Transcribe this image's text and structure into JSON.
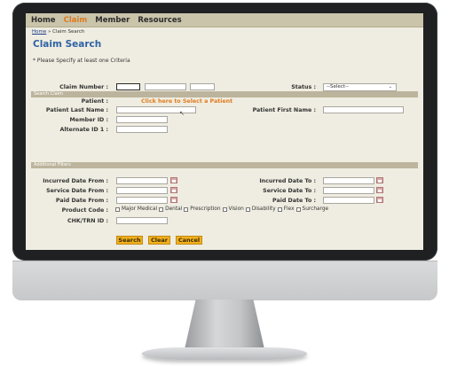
{
  "nav": {
    "home": "Home",
    "claim": "Claim",
    "member": "Member",
    "resources": "Resources"
  },
  "breadcrumb": {
    "home": "Home",
    "separator": " » ",
    "current": "Claim Search"
  },
  "page_title": "Claim Search",
  "criteria_note": "* Please Specify at least one Criteria",
  "search_claim": {
    "section_label": "Search Claim",
    "claim_number_label": "Claim Number :",
    "status_label": "Status :",
    "status_value": "--Select--",
    "patient_label": "Patient :",
    "patient_link": "Click here to Select a Patient",
    "patient_last_label": "Patient Last Name :",
    "patient_first_label": "Patient First Name :",
    "member_id_label": "Member ID :",
    "alternate_id_label": "Alternate ID 1 :"
  },
  "additional_filters": {
    "section_label": "Additional Filters",
    "incurred_from": "Incurred Date From :",
    "incurred_to": "Incurred Date To :",
    "service_from": "Service Date From :",
    "service_to": "Service Date To :",
    "paid_from": "Paid Date From :",
    "paid_to": "Paid Date To :",
    "product_code_label": "Product Code :",
    "products": [
      "Major Medical",
      "Dental",
      "Prescription",
      "Vision",
      "Disability",
      "Flex",
      "Surcharge"
    ],
    "chk_trn_label": "CHK/TRN ID :"
  },
  "buttons": {
    "search": "Search",
    "clear": "Clear",
    "cancel": "Cancel"
  }
}
